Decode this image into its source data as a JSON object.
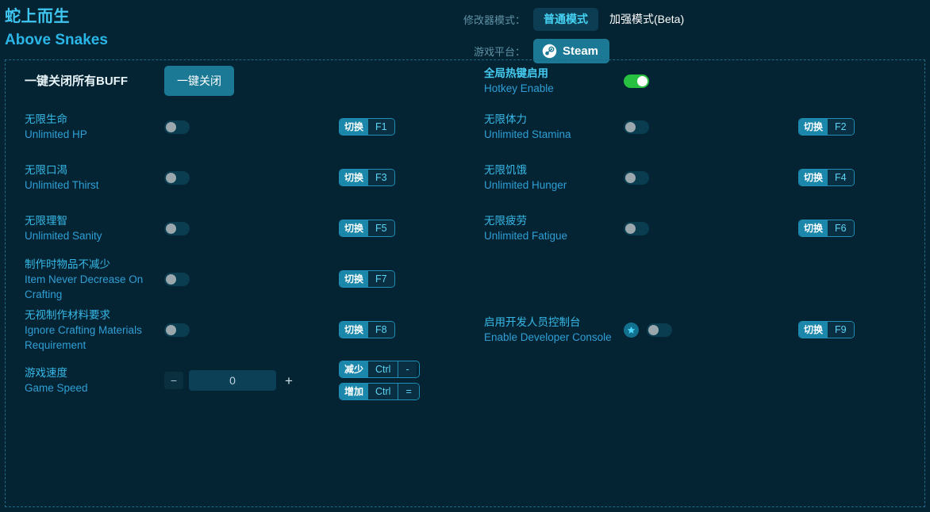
{
  "header": {
    "title_cn": "蛇上而生",
    "title_en": "Above Snakes",
    "mode_label": "修改器模式：",
    "mode_normal": "普通模式",
    "mode_enhanced": "加强模式(Beta)",
    "platform_label": "游戏平台：",
    "platform_value": "Steam",
    "platform_icon": "steam-icon"
  },
  "left": {
    "closeall": {
      "label_cn": "一键关闭所有BUFF",
      "button": "一键关闭"
    },
    "rows": [
      {
        "cn": "无限生命",
        "en": "Unlimited HP",
        "toggle": "off",
        "hk_label": "切换",
        "hk_key": "F1"
      },
      {
        "cn": "无限口渴",
        "en": "Unlimited Thirst",
        "toggle": "off",
        "hk_label": "切换",
        "hk_key": "F3"
      },
      {
        "cn": "无限理智",
        "en": "Unlimited Sanity",
        "toggle": "off",
        "hk_label": "切换",
        "hk_key": "F5"
      },
      {
        "cn": "制作时物品不减少",
        "en": "Item Never Decrease On Crafting",
        "toggle": "off",
        "hk_label": "切换",
        "hk_key": "F7"
      },
      {
        "cn": "无视制作材料要求",
        "en": "Ignore Crafting Materials Requirement",
        "toggle": "off",
        "hk_label": "切换",
        "hk_key": "F8"
      }
    ],
    "speed": {
      "cn": "游戏速度",
      "en": "Game Speed",
      "value": "0",
      "minus": "−",
      "plus": "+",
      "hk_dec_label": "减少",
      "hk_dec_mod": "Ctrl",
      "hk_dec_key": "-",
      "hk_inc_label": "增加",
      "hk_inc_mod": "Ctrl",
      "hk_inc_key": "="
    }
  },
  "right": {
    "hotkey": {
      "cn": "全局热键启用",
      "en": "Hotkey Enable",
      "toggle": "on"
    },
    "rows": [
      {
        "cn": "无限体力",
        "en": "Unlimited Stamina",
        "toggle": "off",
        "hk_label": "切换",
        "hk_key": "F2"
      },
      {
        "cn": "无限饥饿",
        "en": "Unlimited Hunger",
        "toggle": "off",
        "hk_label": "切换",
        "hk_key": "F4"
      },
      {
        "cn": "无限疲劳",
        "en": "Unlimited Fatigue",
        "toggle": "off",
        "hk_label": "切换",
        "hk_key": "F6"
      }
    ],
    "devconsole": {
      "cn": "启用开发人员控制台",
      "en": "Enable Developer Console",
      "toggle": "off",
      "badge_icon": "star-icon",
      "hk_label": "切换",
      "hk_key": "F9"
    }
  },
  "colors": {
    "background": "#042433",
    "accent_teal": "#1b7995",
    "accent_cyan": "#3fc7f2",
    "toggle_on": "#27c040",
    "toggle_off_track": "#0a3d50"
  }
}
